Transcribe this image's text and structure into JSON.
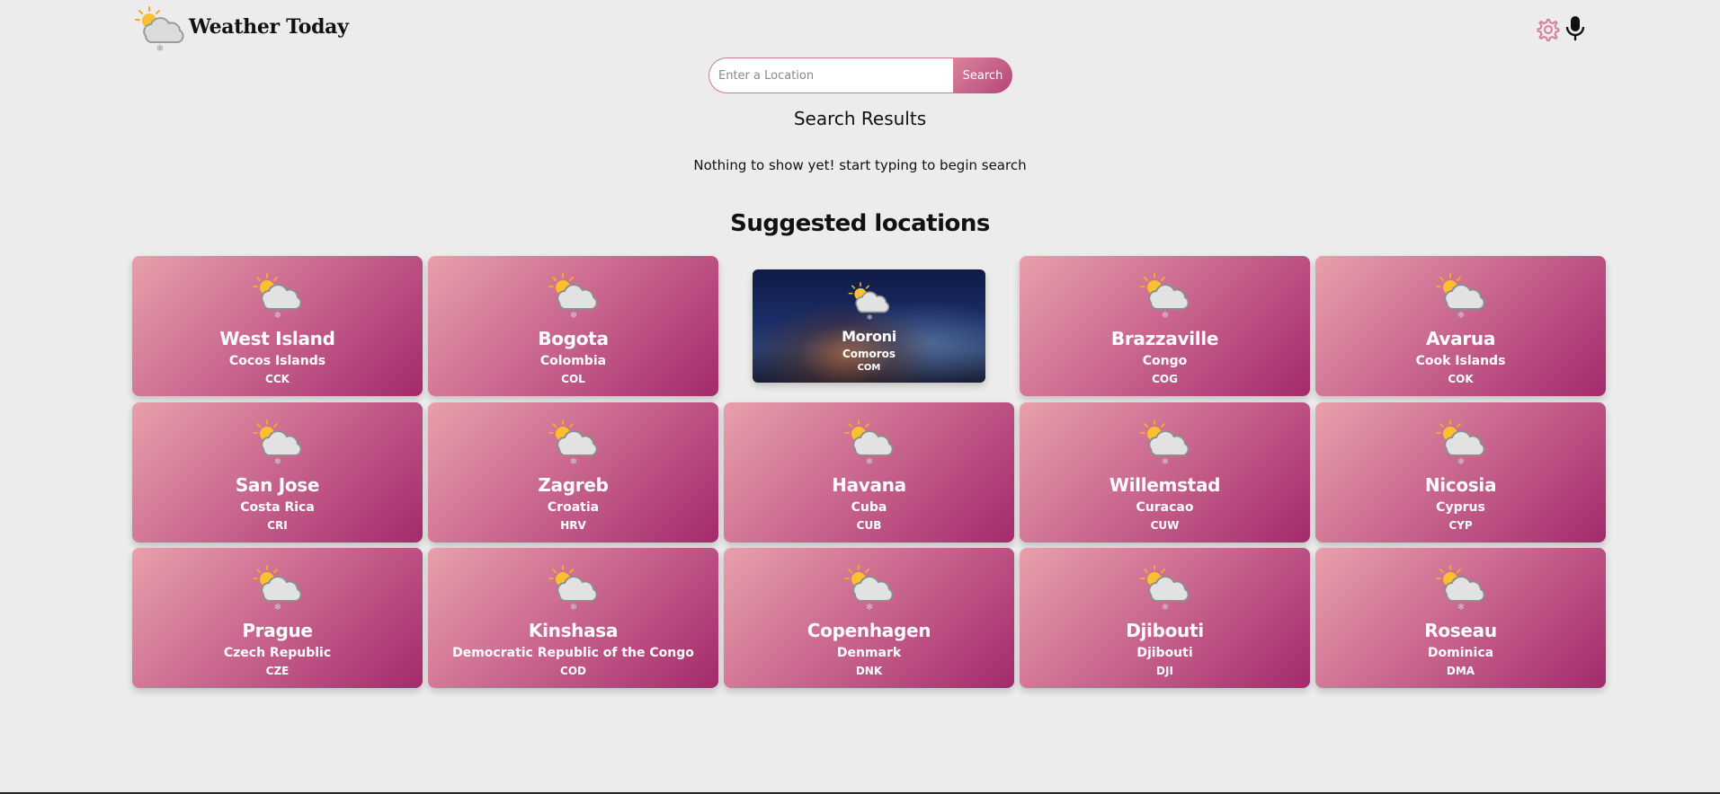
{
  "app": {
    "title": "Weather Today"
  },
  "search": {
    "placeholder": "Enter a Location",
    "value": "",
    "button_label": "Search"
  },
  "results": {
    "title": "Search Results",
    "empty_message": "Nothing to show yet! start typing to begin search"
  },
  "suggested": {
    "title": "Suggested locations",
    "locations": [
      {
        "city": "West Island",
        "country": "Cocos Islands",
        "code": "CCK"
      },
      {
        "city": "Bogota",
        "country": "Colombia",
        "code": "COL"
      },
      {
        "city": "Moroni",
        "country": "Comoros",
        "code": "COM",
        "hovered": true
      },
      {
        "city": "Brazzaville",
        "country": "Congo",
        "code": "COG"
      },
      {
        "city": "Avarua",
        "country": "Cook Islands",
        "code": "COK"
      },
      {
        "city": "San Jose",
        "country": "Costa Rica",
        "code": "CRI"
      },
      {
        "city": "Zagreb",
        "country": "Croatia",
        "code": "HRV"
      },
      {
        "city": "Havana",
        "country": "Cuba",
        "code": "CUB"
      },
      {
        "city": "Willemstad",
        "country": "Curacao",
        "code": "CUW"
      },
      {
        "city": "Nicosia",
        "country": "Cyprus",
        "code": "CYP"
      },
      {
        "city": "Prague",
        "country": "Czech Republic",
        "code": "CZE"
      },
      {
        "city": "Kinshasa",
        "country": "Democratic Republic of the Congo",
        "code": "COD"
      },
      {
        "city": "Copenhagen",
        "country": "Denmark",
        "code": "DNK"
      },
      {
        "city": "Djibouti",
        "country": "Djibouti",
        "code": "DJI"
      },
      {
        "city": "Roseau",
        "country": "Dominica",
        "code": "DMA"
      }
    ]
  },
  "icons": {
    "logo": "sun-cloud-snow-icon",
    "settings": "gear-icon",
    "voice": "microphone-icon",
    "card_weather": "sun-cloud-snow-icon"
  },
  "colors": {
    "accent": "#c8648e",
    "card_gradient_start": "#e8a0aa",
    "card_gradient_end": "#a42a6c",
    "background": "#ececec"
  }
}
